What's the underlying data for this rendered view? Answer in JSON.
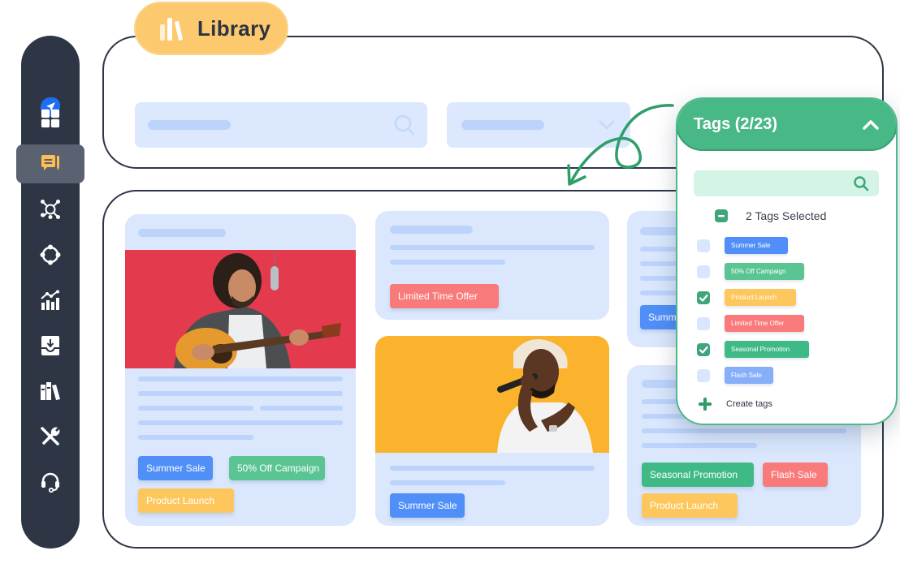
{
  "sidebar": {
    "items": [
      {
        "name": "send",
        "icon": "paper-plane-icon",
        "active": false
      },
      {
        "name": "dashboard",
        "icon": "grid-icon",
        "active": false
      },
      {
        "name": "posts",
        "icon": "message-edit-icon",
        "active": true
      },
      {
        "name": "network",
        "icon": "network-hub-icon",
        "active": false
      },
      {
        "name": "connections",
        "icon": "circle-nodes-icon",
        "active": false
      },
      {
        "name": "analytics",
        "icon": "bar-chart-trend-icon",
        "active": false
      },
      {
        "name": "inbox",
        "icon": "inbox-download-icon",
        "active": false
      },
      {
        "name": "library",
        "icon": "books-icon",
        "active": false
      },
      {
        "name": "tools",
        "icon": "wrench-screwdriver-icon",
        "active": false
      },
      {
        "name": "support",
        "icon": "headset-icon",
        "active": false
      }
    ],
    "colors": {
      "background": "#2e3646",
      "active": "#5a6170",
      "accent": "#fdbf4f",
      "brand": "#1e6ef2"
    }
  },
  "header": {
    "title": "Library",
    "search": {
      "icon": "search-icon"
    },
    "filter": {
      "icon": "chevron-down-icon"
    }
  },
  "cards": [
    {
      "image": "guitarist-singing-red-background",
      "tags": [
        {
          "label": "Summer Sale",
          "color": "blue"
        },
        {
          "label": "50% Off Campaign",
          "color": "green"
        },
        {
          "label": "Product Launch",
          "color": "orange"
        }
      ]
    },
    {
      "image": null,
      "tags": [
        {
          "label": "Limited Time Offer",
          "color": "red"
        }
      ]
    },
    {
      "image": "singer-microphone-yellow-background",
      "tags": [
        {
          "label": "Summer Sale",
          "color": "blue"
        }
      ]
    },
    {
      "image": null,
      "tags": [
        {
          "label": "Summer Sale",
          "color": "blue"
        }
      ]
    },
    {
      "image": null,
      "tags": [
        {
          "label": "Seasonal Promotion",
          "color": "green"
        },
        {
          "label": "Flash Sale",
          "color": "red"
        },
        {
          "label": "Product Launch",
          "color": "orange"
        }
      ]
    }
  ],
  "tags_panel": {
    "title": "Tags (2/23)",
    "selected_summary": "2 Tags Selected",
    "search_placeholder": "",
    "create_label": "Create tags",
    "items": [
      {
        "label": "Summer Sale",
        "checked": false,
        "color": "#4f8ff7"
      },
      {
        "label": "50% Off Campaign",
        "checked": false,
        "color": "#5ac593"
      },
      {
        "label": "Product Launch",
        "checked": true,
        "color": "#fdc75d"
      },
      {
        "label": "Limited Time Offer",
        "checked": false,
        "color": "#f97a7a"
      },
      {
        "label": "Seasonal Promotion",
        "checked": true,
        "color": "#3fba86"
      },
      {
        "label": "Flash Sale",
        "checked": false,
        "color": "#86aef9"
      }
    ],
    "colors": {
      "header": "#49b887",
      "border": "#4db989",
      "search_bg": "#d4f4e6"
    }
  }
}
